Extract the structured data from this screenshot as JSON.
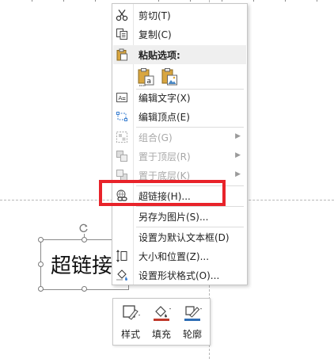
{
  "context_menu": {
    "cut": "剪切(T)",
    "copy": "复制(C)",
    "paste_options": "粘贴选项:",
    "edit_text": "编辑文字(X)",
    "edit_points": "编辑顶点(E)",
    "group": "组合(G)",
    "bring_to_front": "置于顶层(R)",
    "send_to_back": "置于底层(K)",
    "hyperlink": "超链接(H)...",
    "save_as_picture": "另存为图片(S)...",
    "set_default_textbox": "设置为默认文本框(D)",
    "size_and_position": "大小和位置(Z)...",
    "format_shape": "设置形状格式(O)..."
  },
  "slide": {
    "textbox_text": "超链接"
  },
  "mini_toolbar": {
    "style": "样式",
    "fill": "填充",
    "outline": "轮廓"
  },
  "colors": {
    "highlight": "#e8232a",
    "fill_swatch": "#c0392b",
    "outline_swatch": "#2e6db4",
    "paste_header_bg": "#efefef"
  },
  "icons": {
    "cut": "scissors-icon",
    "copy": "copy-icon",
    "paste": "clipboard-icon",
    "paste_keep_text": "paste-text-only-icon",
    "paste_picture": "paste-picture-icon",
    "edit_text": "text-box-icon",
    "edit_points": "edit-points-icon",
    "group": "group-icon",
    "bring_to_front": "bring-front-icon",
    "send_to_back": "send-back-icon",
    "hyperlink": "link-globe-icon",
    "size_position": "size-position-icon",
    "format_shape": "paint-bucket-icon"
  }
}
